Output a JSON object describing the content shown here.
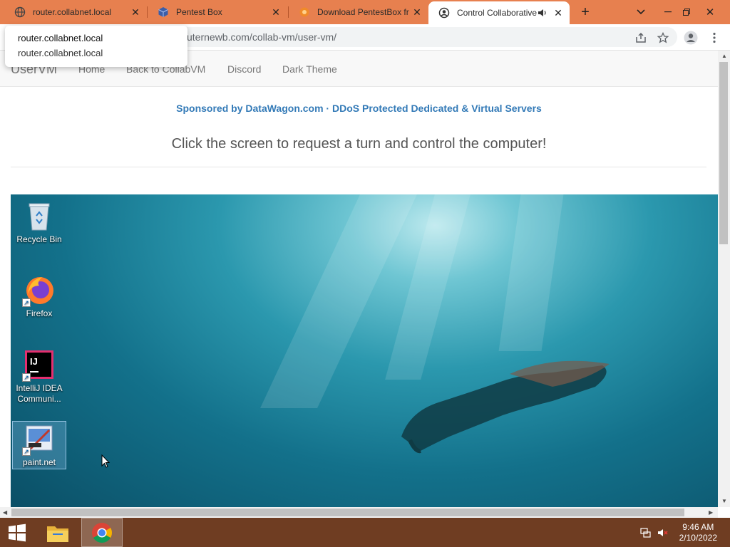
{
  "browser": {
    "tabs": [
      {
        "title": "router.collabnet.local",
        "favicon": "globe-icon"
      },
      {
        "title": "Pentest Box",
        "favicon": "box-icon"
      },
      {
        "title": "Download PentestBox fr",
        "favicon": "pentestbox-icon"
      },
      {
        "title": "Control Collaborative",
        "favicon": "collabvm-icon",
        "active": true
      }
    ],
    "url": "uternewb.com/collab-vm/user-vm/",
    "popup": {
      "line1": "router.collabnet.local",
      "line2": "router.collabnet.local"
    },
    "accent": "#e7804f"
  },
  "page": {
    "brand": "UserVM",
    "nav": [
      "Home",
      "Back to CollabVM",
      "Discord",
      "Dark Theme"
    ],
    "sponsor": "Sponsored by DataWagon.com · DDoS Protected Dedicated & Virtual Servers",
    "lead": "Click the screen to request a turn and control the computer!"
  },
  "vm": {
    "desktop_icons": [
      {
        "label": "Recycle Bin",
        "icon": "recycle-bin-icon"
      },
      {
        "label": "Firefox",
        "icon": "firefox-icon"
      },
      {
        "label": "IntelliJ IDEA Communi...",
        "icon": "intellij-icon"
      },
      {
        "label": "paint.net",
        "icon": "paintnet-icon",
        "selected": true
      }
    ]
  },
  "taskbar": {
    "time": "9:46 AM",
    "date": "2/10/2022",
    "color": "#6f3d22"
  }
}
